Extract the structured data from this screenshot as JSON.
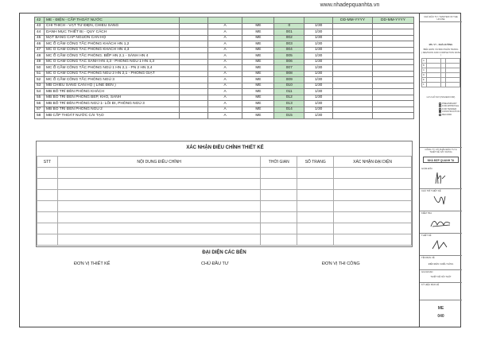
{
  "website": "www.nhadepquanhta.vn",
  "index_section": {
    "num": "42",
    "title": "ME - ĐIỆN - CẤP THOÁT NƯỚC",
    "date1": "DD-MM-YYYY",
    "date2": "DD-MM-YYYY"
  },
  "index_rows": [
    {
      "num": "43",
      "name": "CHỈ THÍCH - VẬT TƯ ĐIỆN, CHIẾU SÁNG",
      "rev": "A",
      "dept": "ME",
      "code": "0",
      "scale": "1/30"
    },
    {
      "num": "44",
      "name": "DANH MỤC THIẾT BỊ - QUY CÁCH",
      "rev": "A",
      "dept": "ME",
      "code": "001",
      "scale": "1/30"
    },
    {
      "num": "45",
      "name": "MẶT BẰNG CẤP NGUỒN CĂN HỘ",
      "rev": "A",
      "dept": "ME",
      "code": "002",
      "scale": "1/30"
    },
    {
      "num": "46",
      "name": "MC Ổ CẮM CÔNG TẮC PHÒNG KHÁCH HN 1,2",
      "rev": "A",
      "dept": "ME",
      "code": "003",
      "scale": "1/30"
    },
    {
      "num": "47",
      "name": "MC Ổ CẮM CÔNG TẮC PHÒNG KHÁCH HN 4,3",
      "rev": "A",
      "dept": "ME",
      "code": "004",
      "scale": "1/30"
    },
    {
      "num": "48",
      "name": "MC Ổ CẮM CÔNG TẮC PHÒNG. BẾP HN 2,1 - SẢNH HN 4",
      "rev": "A",
      "dept": "ME",
      "code": "005",
      "scale": "1/30"
    },
    {
      "num": "49",
      "name": "MC Ổ CẮM CÔNG TẮC SẢNH HN 4,3 - PHÒNG NGỦ 1 HN 4,3",
      "rev": "A",
      "dept": "ME",
      "code": "006",
      "scale": "1/30"
    },
    {
      "num": "50",
      "name": "MC Ổ CẮM CÔNG TẮC PHÒNG NGỦ 1 HN 2,1 - PN 2 HN 3,4",
      "rev": "A",
      "dept": "ME",
      "code": "007",
      "scale": "1/30"
    },
    {
      "num": "51",
      "name": "MC Ổ CẮM CÔNG TẮC PHÒNG NGỦ 2 HN 2,1 - PHÒNG GIẶT",
      "rev": "A",
      "dept": "ME",
      "code": "008",
      "scale": "1/30"
    },
    {
      "num": "52",
      "name": "MC Ổ CẮM CÔNG TẮC PHÒNG NGỦ 3",
      "rev": "A",
      "dept": "ME",
      "code": "009",
      "scale": "1/30"
    },
    {
      "num": "53",
      "name": "MB CHIẾU SÁNG CĂN HỘ ( LINE ĐÈN )",
      "rev": "A",
      "dept": "ME",
      "code": "010",
      "scale": "1/30"
    },
    {
      "num": "54",
      "name": "MB BỐ TRÍ ĐÈN PHÒNG KHÁCH",
      "rev": "A",
      "dept": "ME",
      "code": "011",
      "scale": "1/30"
    },
    {
      "num": "55",
      "name": "MB BỐ TRÍ ĐÈN PHÒNG BẾP, KHO, SẢNH",
      "rev": "A",
      "dept": "ME",
      "code": "012",
      "scale": "1/30"
    },
    {
      "num": "56",
      "name": "MB BỐ TRÍ ĐÈN PHÒNG NGỦ 1- LỐI ĐI, PHÒNG NGỦ 3",
      "rev": "A",
      "dept": "ME",
      "code": "013",
      "scale": "1/30"
    },
    {
      "num": "57",
      "name": "MB BỐ TRÍ ĐÈN PHÒNG NGỦ 2",
      "rev": "A",
      "dept": "ME",
      "code": "014",
      "scale": "1/30"
    },
    {
      "num": "58",
      "name": "MB CẤP THOÁT NƯỚC CÁI TẠO",
      "rev": "A",
      "dept": "ME",
      "code": "015",
      "scale": "1/30"
    }
  ],
  "confirmation": {
    "title": "XÁC NHẬN ĐIỀU CHỈNH THIẾT KẾ",
    "headers": [
      "STT",
      "NỘI DUNG ĐIỀU CHỈNH",
      "THỜI GIAN",
      "SỐ TRANG",
      "XÁC NHẬN ĐẠI DIỆN"
    ]
  },
  "representatives": {
    "title": "ĐẠI DIỆN CÁC BÊN",
    "designer": "ĐƠN VỊ THIẾT KẾ",
    "investor": "CHỦ ĐẦU TƯ",
    "contractor": "ĐƠN VỊ THI CÔNG"
  },
  "title_block": {
    "owner": "CHỦ ĐẦU TƯ / MASTER OF THE HOUSE",
    "project": "MS. VY - NHÀ HƯỜNG",
    "stage": "BIỂU ĐƠN VÀ BẢN PHÂN TRANG",
    "stage2": "( REVISION AND COMPLETION DATE )",
    "company_label": "CÔNG TY CỔ PHẦN ĐẦU TƯ & THIẾT KẾ XÂY DỰNG",
    "company": "NHÀ ĐẸP QUANH TA",
    "status": "LƯU HỒ SƠ (ISSUED FOR)",
    "checks": [
      "PRELIMINARY",
      "FOR APPROVAL",
      "FOR TENDER",
      "CONSTRUCTION",
      "RECORD"
    ],
    "roles": [
      "GIÁM ĐỐC",
      "CHỦ TRÌ THIẾT KẾ",
      "KIỂM TRA",
      "THIẾT KẾ"
    ],
    "drawing_label": "TÊN BẢN VẼ",
    "drawing_name": "ĐIỆN ĐÈN CHIẾU SÁNG",
    "phase_label": "GIAI ĐOẠN",
    "phase": "THIẾT KẾ NỘI THẤT",
    "sheet_label": "KÝ HIỆU BẢN VẼ",
    "sheet_no": "ME",
    "page": "040"
  }
}
